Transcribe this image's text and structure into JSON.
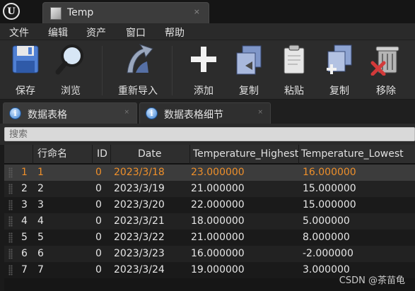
{
  "window": {
    "tab_title": "Temp",
    "tab_close": "×"
  },
  "menu": [
    "文件",
    "编辑",
    "资产",
    "窗口",
    "帮助"
  ],
  "toolbar": {
    "save": "保存",
    "browse": "浏览",
    "reimport": "重新导入",
    "add": "添加",
    "copy": "复制",
    "paste": "粘贴",
    "duplicate": "复制",
    "remove": "移除"
  },
  "panels": {
    "data_table": "数据表格",
    "row_details": "数据表格细节",
    "close": "×"
  },
  "search": {
    "placeholder": "搜索"
  },
  "table": {
    "headers": [
      "行命名",
      "ID",
      "Date",
      "Temperature_Highest",
      "Temperature_Lowest"
    ],
    "rows": [
      {
        "index": "1",
        "name": "1",
        "id": "0",
        "date": "2023/3/18",
        "high": "23.000000",
        "low": "16.000000"
      },
      {
        "index": "2",
        "name": "2",
        "id": "0",
        "date": "2023/3/19",
        "high": "21.000000",
        "low": "15.000000"
      },
      {
        "index": "3",
        "name": "3",
        "id": "0",
        "date": "2023/3/20",
        "high": "22.000000",
        "low": "15.000000"
      },
      {
        "index": "4",
        "name": "4",
        "id": "0",
        "date": "2023/3/21",
        "high": "18.000000",
        "low": "5.000000"
      },
      {
        "index": "5",
        "name": "5",
        "id": "0",
        "date": "2023/3/22",
        "high": "21.000000",
        "low": "8.000000"
      },
      {
        "index": "6",
        "name": "6",
        "id": "0",
        "date": "2023/3/23",
        "high": "16.000000",
        "low": "-2.000000"
      },
      {
        "index": "7",
        "name": "7",
        "id": "0",
        "date": "2023/3/24",
        "high": "19.000000",
        "low": "3.000000"
      }
    ]
  },
  "watermark": "CSDN @茶苗龟",
  "colors": {
    "selected_text": "#ee8f2a",
    "background": "#1a1a1a",
    "accent_blue": "#3a7fd0"
  }
}
